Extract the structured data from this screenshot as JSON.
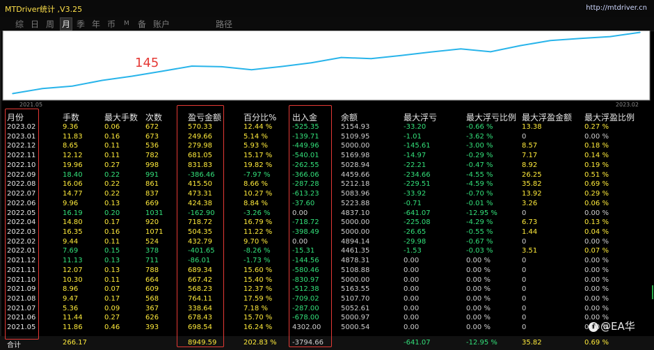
{
  "window": {
    "title": "MTDriver统计 ,V3.25",
    "url": "http://mtdriver.cn"
  },
  "tabs": [
    {
      "label": "综",
      "active": false
    },
    {
      "label": "日",
      "active": false
    },
    {
      "label": "周",
      "active": false
    },
    {
      "label": "月",
      "active": true
    },
    {
      "label": "季",
      "active": false
    },
    {
      "label": "年",
      "active": false
    },
    {
      "label": "币",
      "active": false
    },
    {
      "label": "M",
      "active": false
    },
    {
      "label": "备",
      "active": false
    },
    {
      "label": "账户",
      "active": false
    },
    {
      "label": "路径",
      "active": false
    }
  ],
  "chart_data": {
    "type": "line",
    "annotation": "145",
    "x_start_label": "2021.05",
    "x_end_label": "2023.02",
    "line_color": "#28b4ea",
    "x": [
      "2021.05",
      "2021.06",
      "2021.07",
      "2021.08",
      "2021.09",
      "2021.10",
      "2021.11",
      "2021.12",
      "2022.01",
      "2022.02",
      "2022.03",
      "2022.04",
      "2022.05",
      "2022.06",
      "2022.07",
      "2022.08",
      "2022.09",
      "2022.10",
      "2022.11",
      "2022.12",
      "2023.01",
      "2023.02"
    ],
    "values": [
      698.54,
      1376.97,
      1715.61,
      2479.72,
      3047.95,
      3715.37,
      4404.71,
      4318.7,
      3917.05,
      4349.84,
      4854.19,
      5572.91,
      5410.01,
      5834.39,
      6307.7,
      6723.2,
      6336.74,
      7168.57,
      7849.62,
      8129.6,
      8379.26,
      8949.59
    ]
  },
  "table": {
    "headers": [
      "月份",
      "手数",
      "最大手数",
      "次数",
      "盈亏金额",
      "百分比%",
      "出入金",
      "余额",
      "最大浮亏",
      "最大浮亏比例",
      "最大浮盈金额",
      "最大浮盈比例"
    ],
    "rows": [
      [
        "2023.02",
        "9.36",
        "0.06",
        "672",
        "570.33",
        "12.44 %",
        "-525.35",
        "5154.93",
        "-33.20",
        "-0.66 %",
        "13.38",
        "0.27 %"
      ],
      [
        "2023.01",
        "11.83",
        "0.16",
        "673",
        "249.66",
        "5.14 %",
        "-139.71",
        "5109.95",
        "-1.01",
        "-3.62 %",
        "0",
        "0.00 %"
      ],
      [
        "2022.12",
        "8.65",
        "0.11",
        "536",
        "279.98",
        "5.93 %",
        "-449.96",
        "5000.00",
        "-145.61",
        "-3.00 %",
        "8.57",
        "0.18 %"
      ],
      [
        "2022.11",
        "12.12",
        "0.11",
        "782",
        "681.05",
        "15.17 %",
        "-540.01",
        "5169.98",
        "-14.97",
        "-0.29 %",
        "7.17",
        "0.14 %"
      ],
      [
        "2022.10",
        "19.96",
        "0.27",
        "998",
        "831.83",
        "19.82 %",
        "-262.55",
        "5028.94",
        "-22.21",
        "-0.47 %",
        "8.92",
        "0.19 %"
      ],
      [
        "2022.09",
        "18.40",
        "0.22",
        "991",
        "-386.46",
        "-7.97 %",
        "-366.06",
        "4459.66",
        "-234.66",
        "-4.55 %",
        "26.25",
        "0.51 %"
      ],
      [
        "2022.08",
        "16.06",
        "0.22",
        "861",
        "415.50",
        "8.66 %",
        "-287.28",
        "5212.18",
        "-229.51",
        "-4.59 %",
        "35.82",
        "0.69 %"
      ],
      [
        "2022.07",
        "14.77",
        "0.22",
        "837",
        "473.31",
        "10.27 %",
        "-613.23",
        "5083.96",
        "-33.92",
        "-0.70 %",
        "13.92",
        "0.29 %"
      ],
      [
        "2022.06",
        "9.96",
        "0.13",
        "669",
        "424.38",
        "8.84 %",
        "-37.60",
        "5223.88",
        "-0.71",
        "-0.01 %",
        "3.26",
        "0.06 %"
      ],
      [
        "2022.05",
        "16.19",
        "0.20",
        "1031",
        "-162.90",
        "-3.26 %",
        "0.00",
        "4837.10",
        "-641.07",
        "-12.95 %",
        "0",
        "0.00 %"
      ],
      [
        "2022.04",
        "14.80",
        "0.17",
        "920",
        "718.72",
        "16.79 %",
        "-718.72",
        "5000.00",
        "-225.08",
        "-4.29 %",
        "6.73",
        "0.13 %"
      ],
      [
        "2022.03",
        "16.35",
        "0.16",
        "1071",
        "504.35",
        "11.22 %",
        "-398.49",
        "5000.00",
        "-26.65",
        "-0.55 %",
        "1.44",
        "0.04 %"
      ],
      [
        "2022.02",
        "9.44",
        "0.11",
        "524",
        "432.79",
        "9.70 %",
        "0.00",
        "4894.14",
        "-29.98",
        "-0.67 %",
        "0",
        "0.00 %"
      ],
      [
        "2022.01",
        "7.69",
        "0.15",
        "378",
        "-401.65",
        "-8.26 %",
        "-15.31",
        "4461.35",
        "-1.53",
        "-0.03 %",
        "3.51",
        "0.07 %"
      ],
      [
        "2021.12",
        "11.13",
        "0.13",
        "711",
        "-86.01",
        "-1.73 %",
        "-144.56",
        "4878.31",
        "0.00",
        "0.00 %",
        "0",
        "0.00 %"
      ],
      [
        "2021.11",
        "12.07",
        "0.13",
        "788",
        "689.34",
        "15.60 %",
        "-580.46",
        "5108.88",
        "0.00",
        "0.00 %",
        "0",
        "0.00 %"
      ],
      [
        "2021.10",
        "10.30",
        "0.11",
        "664",
        "667.42",
        "15.40 %",
        "-830.97",
        "5000.00",
        "0.00",
        "0.00 %",
        "0",
        "0.00 %"
      ],
      [
        "2021.09",
        "8.96",
        "0.07",
        "609",
        "568.23",
        "12.37 %",
        "-512.38",
        "5163.55",
        "0.00",
        "0.00 %",
        "0",
        "0.00 %"
      ],
      [
        "2021.08",
        "9.47",
        "0.17",
        "568",
        "764.11",
        "17.59 %",
        "-709.02",
        "5107.70",
        "0.00",
        "0.00 %",
        "0",
        "0.00 %"
      ],
      [
        "2021.07",
        "5.36",
        "0.09",
        "367",
        "338.64",
        "7.18 %",
        "-287.00",
        "5052.61",
        "0.00",
        "0.00 %",
        "0",
        "0.00 %"
      ],
      [
        "2021.06",
        "11.44",
        "0.27",
        "626",
        "678.43",
        "15.70 %",
        "-678.00",
        "5000.97",
        "0.00",
        "0.00 %",
        "0",
        "0.00 %"
      ],
      [
        "2021.05",
        "11.86",
        "0.46",
        "393",
        "698.54",
        "16.24 %",
        "4302.00",
        "5000.54",
        "0.00",
        "0.00 %",
        "0",
        "0.00 %"
      ]
    ],
    "total": [
      "合计",
      "266.17",
      "",
      "",
      "8949.59",
      "202.83 %",
      "-3794.66",
      "",
      "-641.07",
      "-12.95 %",
      "35.82",
      "0.69 %"
    ]
  },
  "watermark": {
    "icon": "facebook-icon",
    "text": "@EA华"
  }
}
